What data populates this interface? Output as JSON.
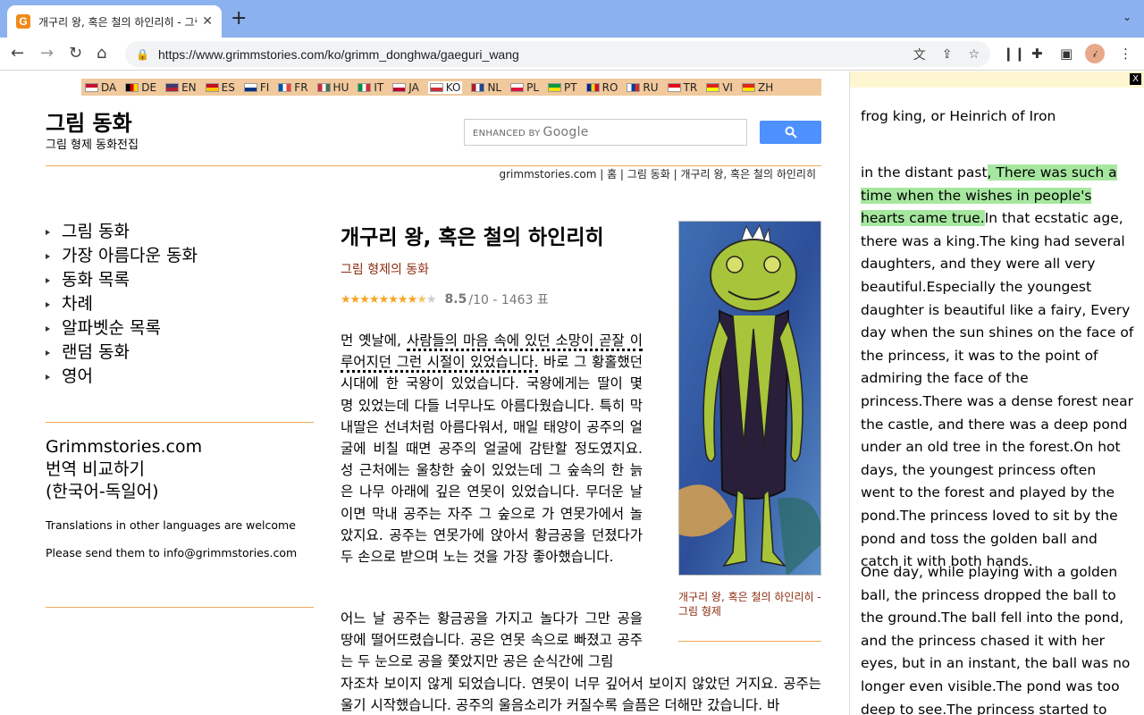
{
  "browser": {
    "tab_title": "개구리 왕, 혹은 철의 하인리히 - 그림",
    "tab_favicon": "G",
    "url": "https://www.grimmstories.com/ko/grimm_donghwa/gaeguri_wang",
    "icons": [
      "back-icon",
      "forward-icon",
      "reload-icon",
      "home-icon",
      "lock-icon",
      "translate-icon",
      "share-icon",
      "star-icon",
      "reader-icon",
      "extensions-icon",
      "sidepanel-icon",
      "profile-avatar",
      "menu-icon"
    ]
  },
  "languages": [
    {
      "code": "DA",
      "colors": [
        "#c8102e",
        "#ffffff"
      ]
    },
    {
      "code": "DE",
      "colors": [
        "#000000",
        "#dd0000",
        "#ffce00"
      ]
    },
    {
      "code": "EN",
      "colors": [
        "#3c3b6e",
        "#b22234"
      ]
    },
    {
      "code": "ES",
      "colors": [
        "#c60b1e",
        "#ffc400"
      ]
    },
    {
      "code": "FI",
      "colors": [
        "#ffffff",
        "#003580"
      ]
    },
    {
      "code": "FR",
      "colors": [
        "#0055a4",
        "#ffffff",
        "#ef4135"
      ]
    },
    {
      "code": "HU",
      "colors": [
        "#ce2939",
        "#ffffff",
        "#477050"
      ]
    },
    {
      "code": "IT",
      "colors": [
        "#009246",
        "#ffffff",
        "#ce2b37"
      ]
    },
    {
      "code": "JA",
      "colors": [
        "#ffffff",
        "#bc002d"
      ]
    },
    {
      "code": "KO",
      "colors": [
        "#ffffff",
        "#cd2e3a"
      ],
      "active": true
    },
    {
      "code": "NL",
      "colors": [
        "#ae1c28",
        "#ffffff",
        "#21468b"
      ]
    },
    {
      "code": "PL",
      "colors": [
        "#ffffff",
        "#dc143c"
      ]
    },
    {
      "code": "PT",
      "colors": [
        "#009c3b",
        "#ffdf00"
      ]
    },
    {
      "code": "RO",
      "colors": [
        "#002b7f",
        "#fcd116",
        "#ce1126"
      ]
    },
    {
      "code": "RU",
      "colors": [
        "#ffffff",
        "#0039a6",
        "#d52b1e"
      ]
    },
    {
      "code": "TR",
      "colors": [
        "#e30a17",
        "#ffffff"
      ]
    },
    {
      "code": "VI",
      "colors": [
        "#da251d",
        "#ffff00"
      ]
    },
    {
      "code": "ZH",
      "colors": [
        "#de2910",
        "#ffde00"
      ]
    }
  ],
  "header": {
    "title": "그림 동화",
    "subtitle": "그림 형제 동화전집",
    "search_hint": "ENHANCED BY",
    "search_brand": "Google"
  },
  "breadcrumb": "grimmstories.com | 홈 | 그림 동화 | 개구리 왕, 혹은 철의 하인리히",
  "sidebar": {
    "items": [
      "그림 동화",
      "가장 아름다운 동화",
      "동화 목록",
      "차례",
      "알파벳순 목록",
      "랜덤 동화",
      "영어"
    ],
    "compare_line1": "Grimmstories.com",
    "compare_line2": "번역 비교하기",
    "compare_line3": "(한국어-독일어)",
    "note1": "Translations in other languages are welcome",
    "note2": "Please send them to info@grimmstories.com"
  },
  "story": {
    "title": "개구리 왕, 혹은 철의 하인리히",
    "author": "그림 형제의 동화",
    "rating_value": "8.5",
    "rating_rest": "/10 - 1463 표",
    "rating_fraction": 0.85,
    "para1_pre": "먼 옛날에, ",
    "para1_hl": "사람들의 마음 속에 있던 소망이 곧잘 이루어지던 그런 시절이 있었습니다.",
    "para1_post": " 바로 그 황홀했던 시대에 한 국왕이 있었습니다. 국왕에게는 딸이 몇 명 있었는데 다들 너무나도 아름다웠습니다. 특히 막내딸은 선녀처럼 아름다워서, 매일 태양이 공주의 얼굴에 비칠 때면 공주의 얼굴에 감탄할 정도였지요. 성 근처에는 울창한 숲이 있었는데 그 숲속의 한 늙은 나무 아래에 깊은 연못이 있었습니다. 무더운 날이면 막내 공주는 자주 그 숲으로 가 연못가에서 놀았지요. 공주는 연못가에 앉아서 황금공을 던졌다가 두 손으로 받으며 노는 것을 가장 좋아했습니다.",
    "para2_narrow": "어느 날 공주는 황금공을 가지고 놀다가 그만 공을 땅에 떨어뜨렸습니다. 공은 연못 속으로 빠졌고 공주는 두 눈으로 공을 쫓았지만 공은 순식간에 그림",
    "para2_wide": "자조차 보이지 않게 되었습니다. 연못이 너무 깊어서 보이지 않았던 거지요. 공주는 울기 시작했습니다. 공주의 울음소리가 커질수록 슬픔은 더해만 갔습니다. 바",
    "caption": "개구리 왕, 혹은 철의 하인리히 - 그림 형제"
  },
  "translation_panel": {
    "close": "X",
    "title": "frog king, or Heinrich of Iron",
    "p1_pre": "in the distant past",
    "p1_hl": ", There was such a time when the wishes in people's hearts came true.",
    "p1_post": "In that ecstatic age, there was a king.The king had several daughters, and they were all very beautiful.Especially the youngest daughter is beautiful like a fairy, Every day when the sun shines on the face of the princess, it was to the point of admiring the face of the princess.There was a dense forest near the castle, and there was a deep pond under an old tree in the forest.On hot days, the youngest princess often went to the forest and played by the pond.The princess loved to sit by the pond and toss the golden ball and catch it with both hands.",
    "p2": "One day, while playing with a golden ball, the princess dropped the ball to the ground.The ball fell into the pond, and the princess chased it with her eyes, but in an instant, the ball was no longer even visible.The pond was too deep to see.The princess started to cry.The more the"
  }
}
